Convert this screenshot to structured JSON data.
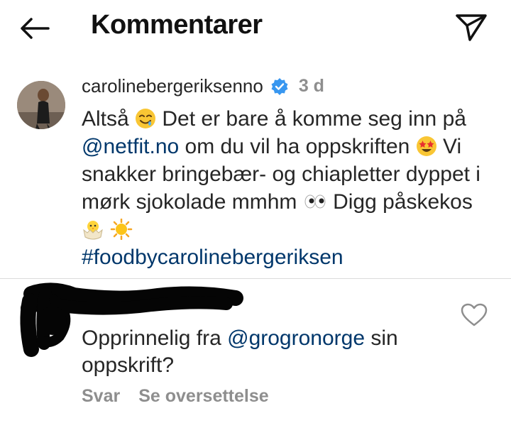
{
  "header": {
    "title": "Kommentarer",
    "back_icon": "arrow-left-icon",
    "send_icon": "paper-plane-icon"
  },
  "comment1": {
    "username": "carolinebergeriksenno",
    "verified_icon": "verified-badge-icon",
    "verified_color": "#3897f0",
    "time": "3 d",
    "text_1": "Altså",
    "text_2": " Det er bare å komme seg inn på ",
    "mention": "@netfit.no",
    "text_3": " om du vil ha oppskriften",
    "text_4": " Vi snakker bringebær- og chiapletter dyppet i mørk sjokolade mmhm",
    "text_5": " Digg påskekos",
    "hashtag": "#foodbycarolinebergeriksen",
    "emojis": [
      "drooling-face-emoji",
      "star-struck-emoji",
      "eyes-emoji",
      "hatching-chick-emoji",
      "sun-emoji"
    ]
  },
  "comment2": {
    "text_1": "Opprinnelig fra ",
    "mention": "@grogronorge",
    "text_2": " sin oppskrift?",
    "reply_label": "Svar",
    "translate_label": "Se oversettelse",
    "like_icon": "heart-outline-icon"
  },
  "colors": {
    "link": "#00376b",
    "muted": "#8e8e8e",
    "text": "#262626"
  }
}
